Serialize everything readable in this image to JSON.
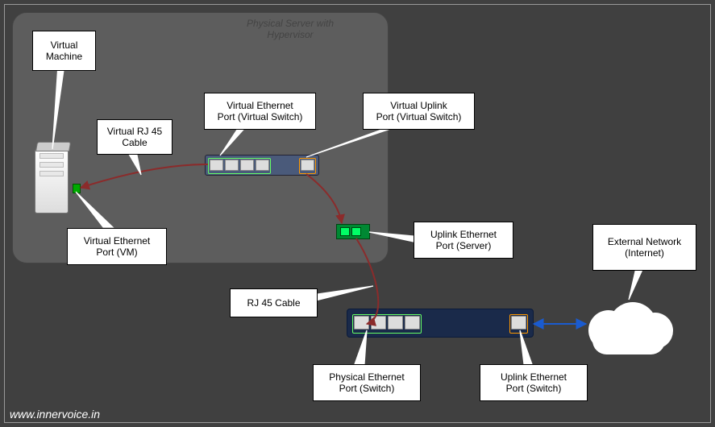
{
  "diagram": {
    "hypervisor_title": "Physical Server with\nHypervisor",
    "watermark": "www.innervoice.in"
  },
  "callouts": {
    "vm": "Virtual\nMachine",
    "vrj45": "Virtual RJ 45\nCable",
    "veth_switch": "Virtual Ethernet\nPort (Virtual Switch)",
    "vuplink": "Virtual Uplink\nPort (Virtual Switch)",
    "veth_vm": "Virtual Ethernet\nPort (VM)",
    "uplink_server": "Uplink Ethernet\nPort (Server)",
    "rj45": "RJ 45 Cable",
    "phys_port": "Physical Ethernet\nPort (Switch)",
    "uplink_switch": "Uplink Ethernet\nPort (Switch)",
    "ext_net": "External Network\n(Internet)"
  }
}
